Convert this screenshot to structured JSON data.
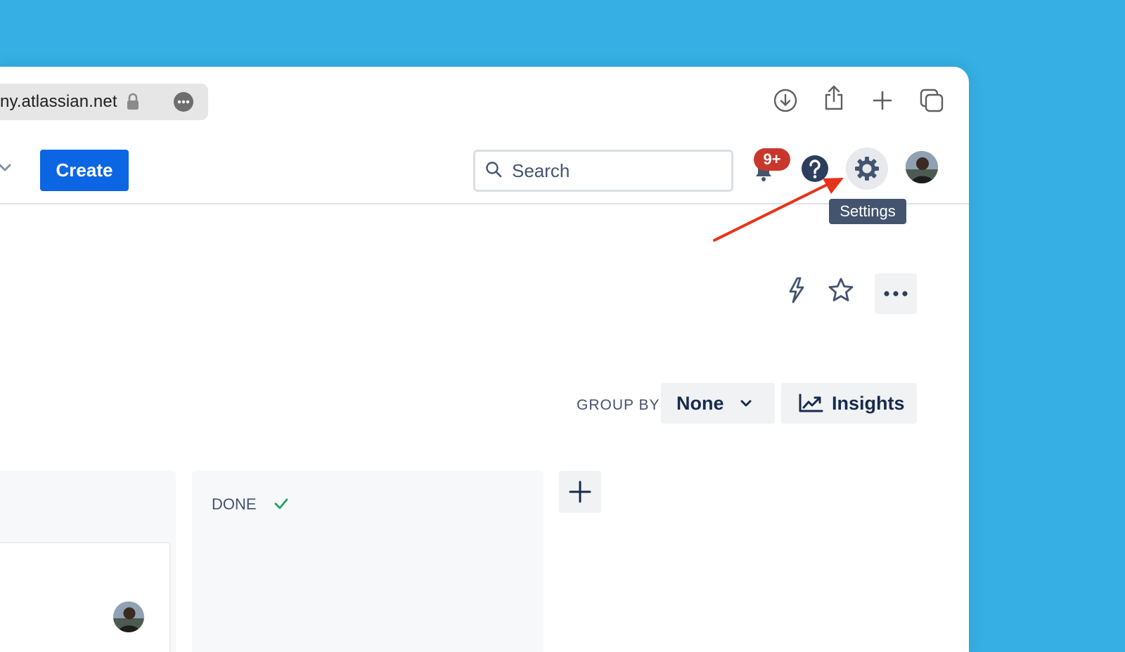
{
  "browser": {
    "url": "ny.atlassian.net"
  },
  "header": {
    "create_label": "Create",
    "search_placeholder": "Search",
    "notification_count": "9+",
    "settings_tooltip": "Settings"
  },
  "toolbar": {
    "group_by_label": "GROUP BY",
    "group_by_value": "None",
    "insights_label": "Insights"
  },
  "board": {
    "columns": [
      {
        "title": "DONE"
      }
    ]
  },
  "colors": {
    "background": "#35afe4",
    "primary": "#0c66e4",
    "badge": "#c9372c",
    "annotation_arrow": "#e8331c",
    "done_check": "#22a06b"
  }
}
